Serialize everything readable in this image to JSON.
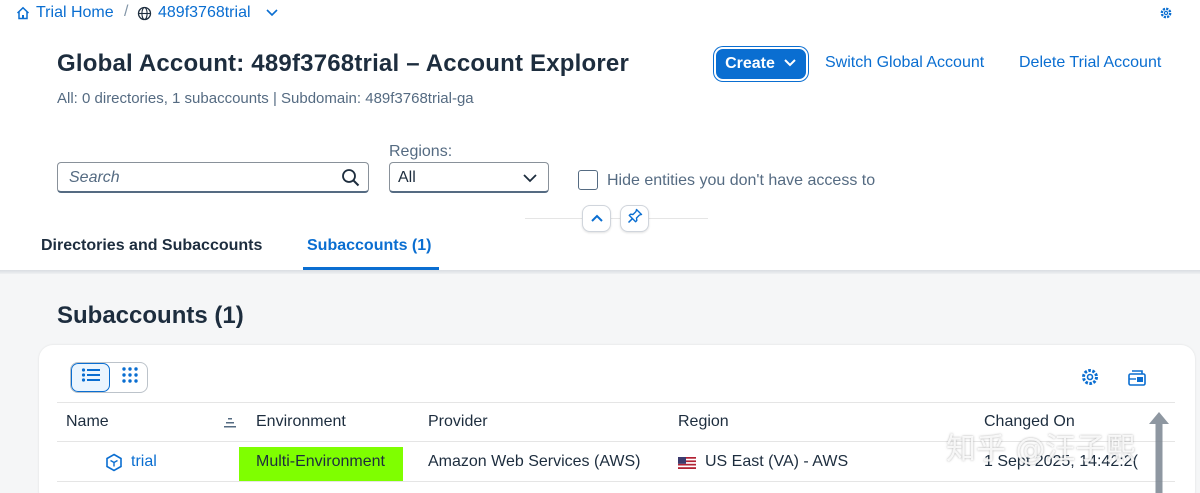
{
  "breadcrumb": {
    "home": "Trial Home",
    "separator": "/",
    "account": "489f3768trial"
  },
  "header": {
    "title": "Global Account: 489f3768trial – Account Explorer",
    "subtitle": "All: 0 directories, 1 subaccounts | Subdomain: 489f3768trial-ga",
    "create_label": "Create",
    "switch_label": "Switch Global Account",
    "delete_label": "Delete Trial Account"
  },
  "filters": {
    "search_placeholder": "Search",
    "regions_label": "Regions:",
    "regions_value": "All",
    "hide_label": "Hide entities you don't have access to"
  },
  "tabs": [
    {
      "label": "Directories and Subaccounts",
      "selected": false
    },
    {
      "label": "Subaccounts (1)",
      "selected": true
    }
  ],
  "section": {
    "title": "Subaccounts (1)"
  },
  "table": {
    "columns": [
      "Name",
      "Environment",
      "Provider",
      "Region",
      "Changed On"
    ],
    "rows": [
      {
        "name": "trial",
        "environment": "Multi-Environment",
        "provider": "Amazon Web Services (AWS)",
        "region": "US East (VA) - AWS",
        "changed_on": "1 Sept 2025, 14:42:2("
      }
    ]
  },
  "watermark": "知乎 @汪子熙",
  "colors": {
    "accent": "#0a6ed1",
    "highlight": "#7fff00",
    "text": "#1d2d3e",
    "muted": "#556b82"
  },
  "icons": [
    "home-icon",
    "globe-icon",
    "chevron-down-icon",
    "settings-icon",
    "search-icon",
    "collapse-up-icon",
    "pin-icon",
    "list-view-icon",
    "grid-view-icon",
    "export-icon",
    "subaccount-icon",
    "us-flag-icon",
    "sort-icon"
  ]
}
